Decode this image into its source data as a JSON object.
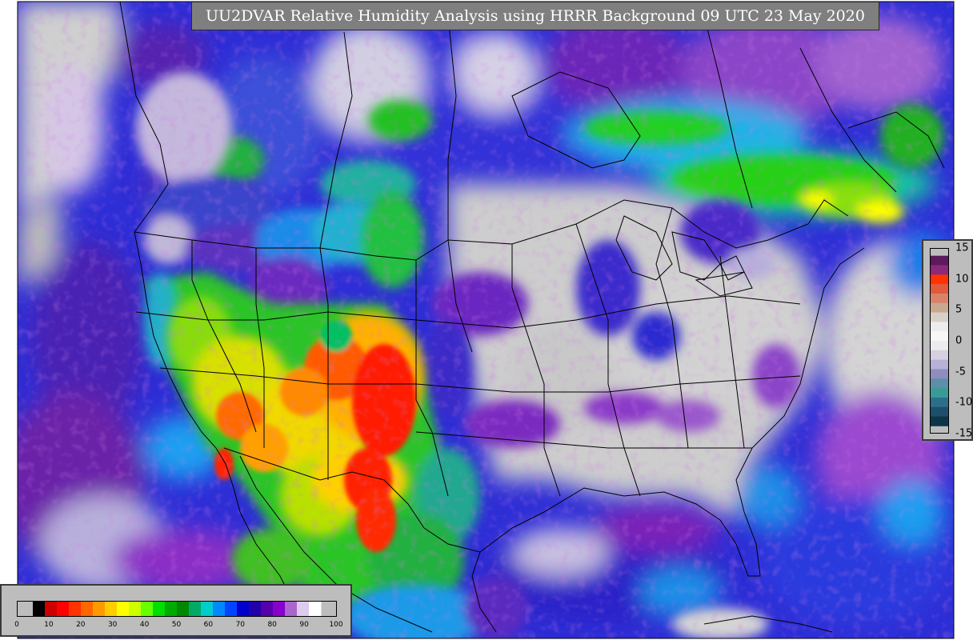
{
  "title": "UU2DVAR Relative Humidity Analysis using HRRR Background 09 UTC 23 May 2020",
  "rh_colorbar": {
    "min": 0,
    "max": 100,
    "ticks": [
      "0",
      "10",
      "20",
      "30",
      "40",
      "50",
      "60",
      "70",
      "80",
      "90",
      "100"
    ],
    "colors": [
      "#000000",
      "#cc0000",
      "#ff0000",
      "#ff3300",
      "#ff6600",
      "#ff9900",
      "#ffcc00",
      "#ffff00",
      "#ccff00",
      "#66ff00",
      "#00dd00",
      "#00aa00",
      "#008800",
      "#00aa66",
      "#00cccc",
      "#0088ff",
      "#0044ff",
      "#0000cc",
      "#2200aa",
      "#5500aa",
      "#8800cc",
      "#aa66cc",
      "#ddccee",
      "#ffffff"
    ]
  },
  "diff_colorbar": {
    "min": -15,
    "max": 15,
    "ticks": [
      "15",
      "10",
      "5",
      "0",
      "-5",
      "-10",
      "-15"
    ],
    "colors": [
      "#5c1a5c",
      "#8b2a7a",
      "#ff3300",
      "#e05a3c",
      "#d9826a",
      "#c9a890",
      "#d9cfc9",
      "#ececec",
      "#f7f7f7",
      "#ececec",
      "#d6d0e0",
      "#b8b2d6",
      "#8f8cc0",
      "#5e8fa8",
      "#3a9a98",
      "#2d6f8a",
      "#1e4f6a",
      "#0d3548"
    ]
  },
  "map": {
    "projection": "lambert-conformal",
    "field": "relative humidity",
    "ocean_color": "#3a3ad8",
    "land_moist_color": "#c8c8c8",
    "dry_color": "#ff2a00"
  }
}
